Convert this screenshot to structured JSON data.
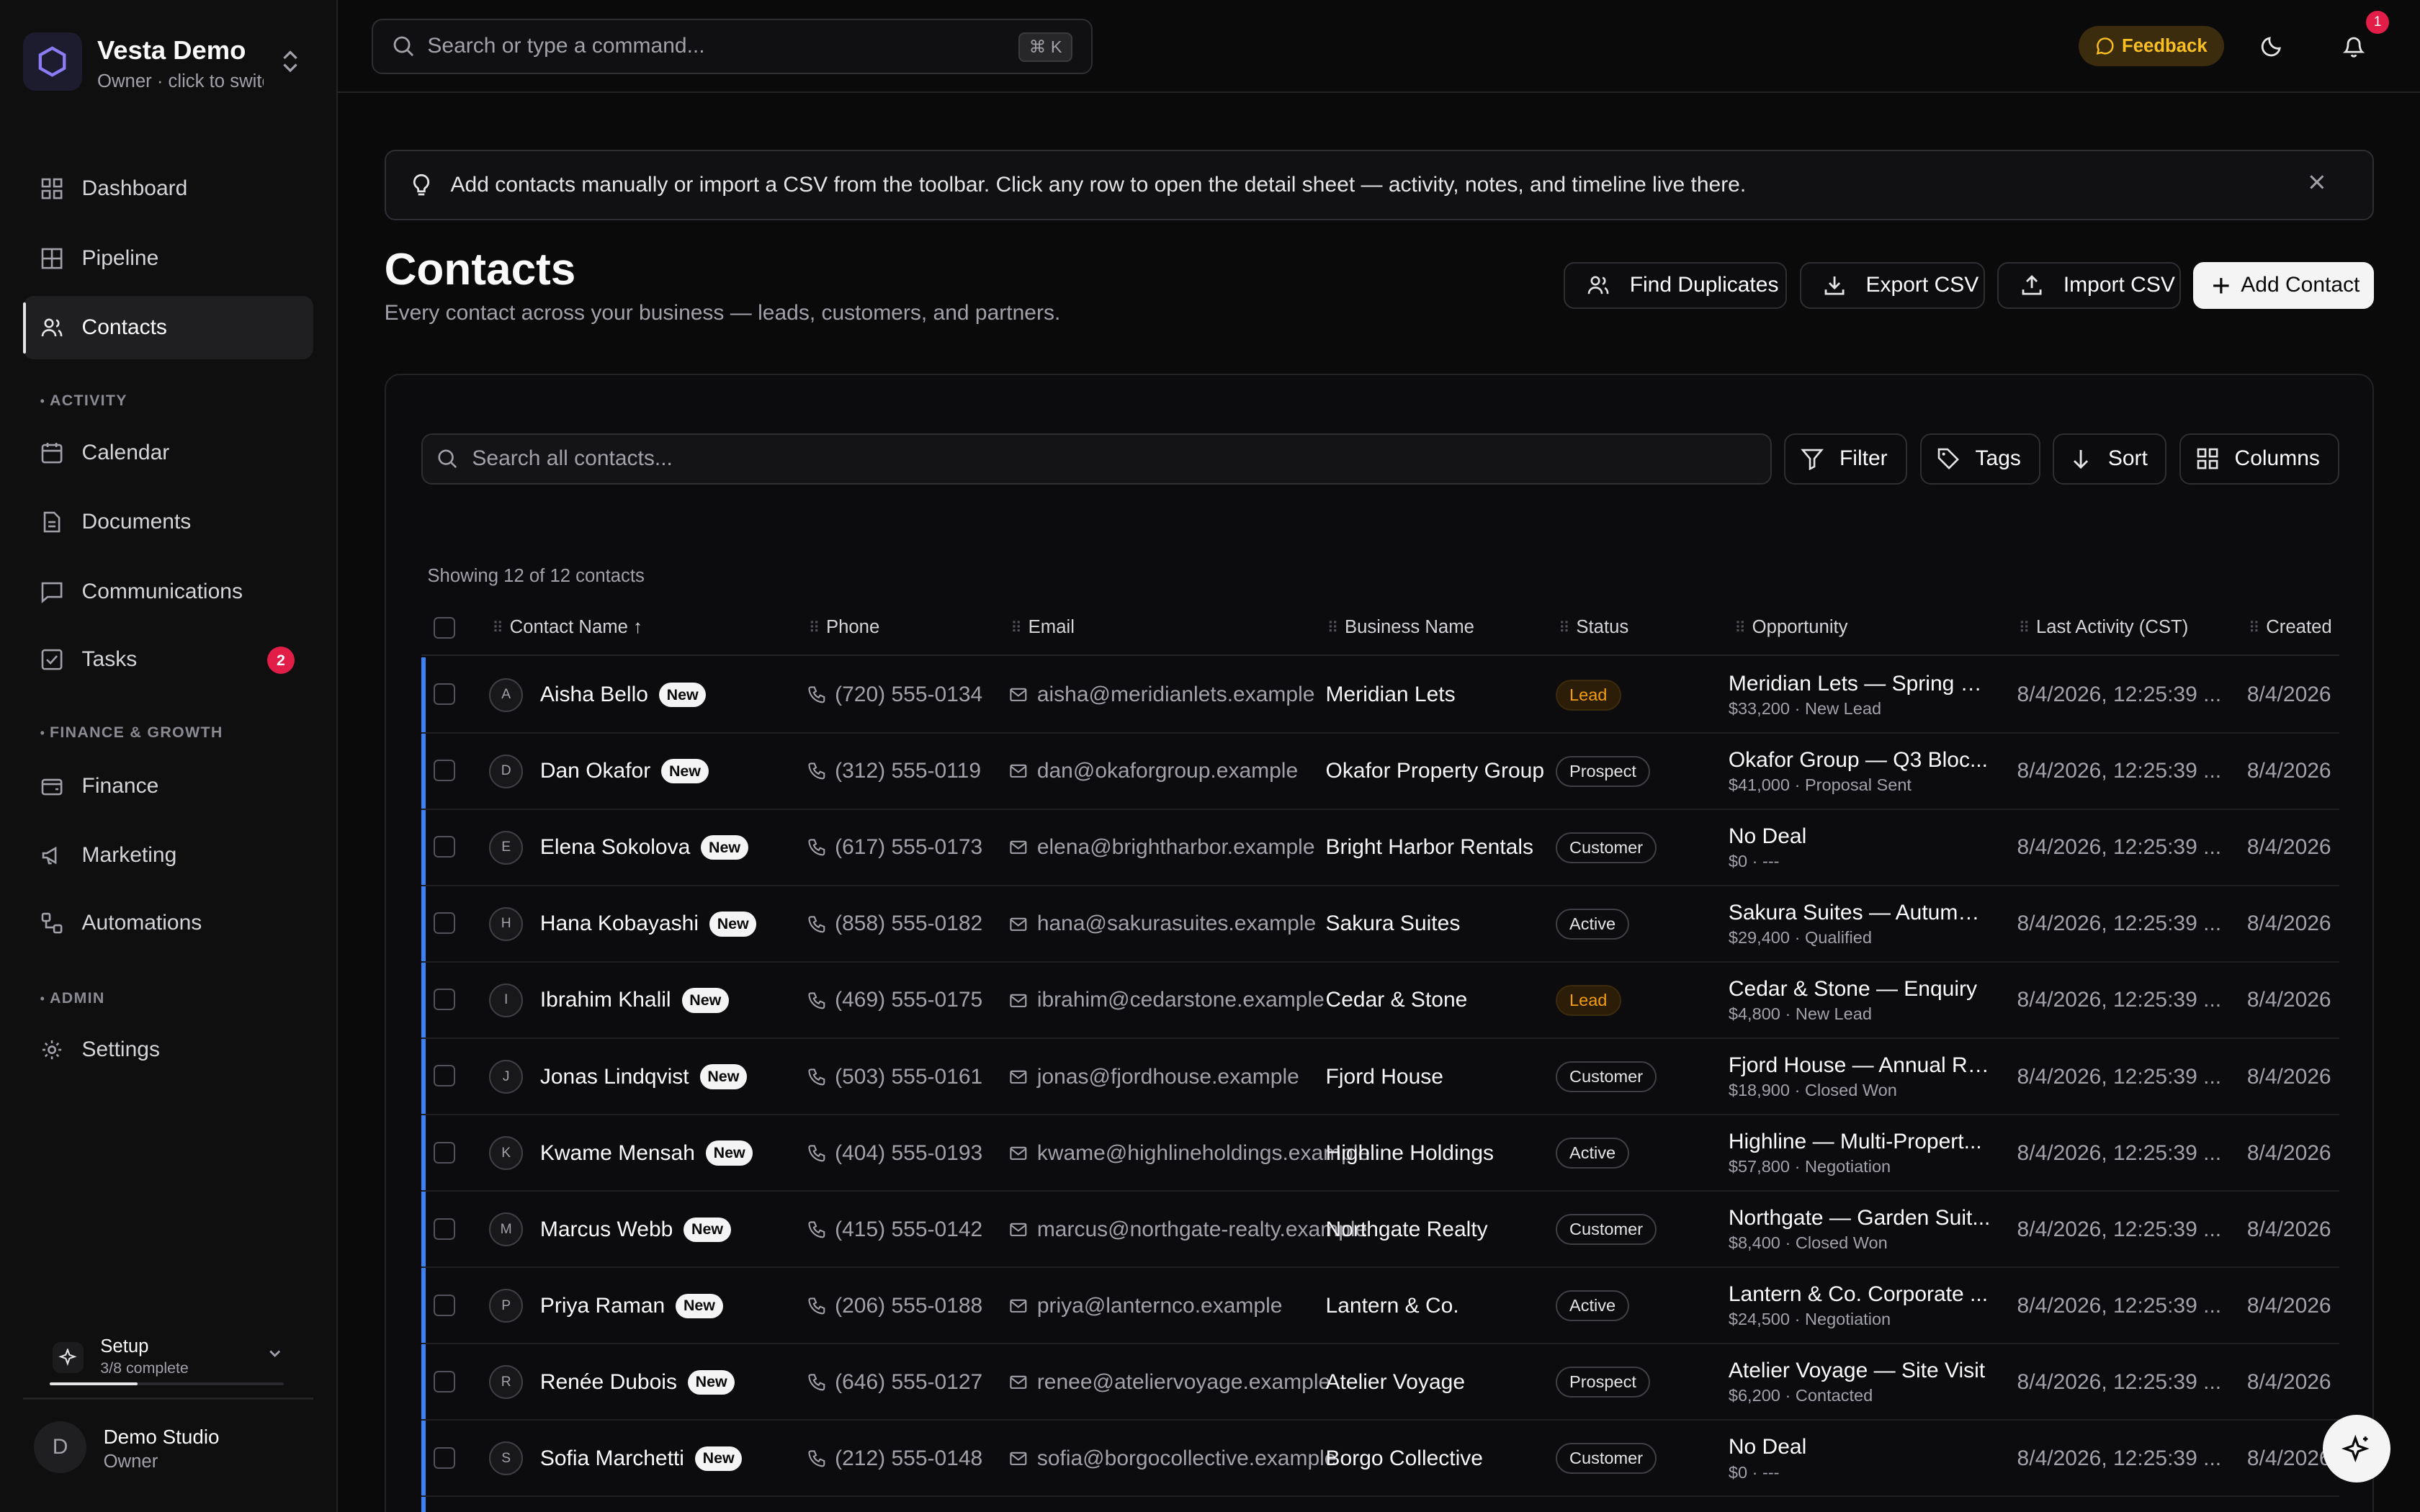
{
  "workspace": {
    "name": "Vesta Demo",
    "subtitle": "Owner · click to switch"
  },
  "sidebar": {
    "items": [
      {
        "label": "Dashboard"
      },
      {
        "label": "Pipeline"
      },
      {
        "label": "Contacts"
      },
      {
        "label": "Calendar"
      },
      {
        "label": "Documents"
      },
      {
        "label": "Communications"
      },
      {
        "label": "Tasks",
        "badge": "2"
      },
      {
        "label": "Finance"
      },
      {
        "label": "Marketing"
      },
      {
        "label": "Automations"
      },
      {
        "label": "Settings"
      }
    ],
    "sections": [
      "ACTIVITY",
      "FINANCE & GROWTH",
      "ADMIN"
    ],
    "active": "Contacts"
  },
  "setup": {
    "title": "Setup",
    "progress_text": "3/8 complete",
    "progress": 0.375
  },
  "user": {
    "initial": "D",
    "name": "Demo Studio",
    "role": "Owner"
  },
  "topbar": {
    "search_placeholder": "Search or type a command...",
    "shortcut": "⌘ K",
    "feedback_label": "Feedback",
    "notification_count": "1"
  },
  "banner": {
    "text": "Add contacts manually or import a CSV from the toolbar. Click any row to open the detail sheet — activity, notes, and timeline live there."
  },
  "page": {
    "title": "Contacts",
    "subtitle": "Every contact across your business — leads, customers, and partners."
  },
  "actions": {
    "find_duplicates": "Find Duplicates",
    "export_csv": "Export CSV",
    "import_csv": "Import CSV",
    "add_contact": "Add Contact"
  },
  "toolbar": {
    "search_placeholder": "Search all contacts...",
    "filter": "Filter",
    "tags": "Tags",
    "sort": "Sort",
    "columns": "Columns"
  },
  "table": {
    "showing": "Showing 12 of 12 contacts",
    "columns": [
      "Contact Name",
      "Phone",
      "Email",
      "Business Name",
      "Status",
      "Opportunity",
      "Last Activity (CST)",
      "Created"
    ],
    "new_label": "New",
    "rows": [
      {
        "initial": "A",
        "name": "Aisha Bello",
        "phone": "(720) 555-0134",
        "email": "aisha@meridianlets.example",
        "business": "Meridian Lets",
        "status": "Lead",
        "opp_title": "Meridian Lets — Spring B...",
        "opp_sub": "$33,200 · New Lead",
        "last": "8/4/2026, 12:25:39 ...",
        "created": "8/4/2026"
      },
      {
        "initial": "D",
        "name": "Dan Okafor",
        "phone": "(312) 555-0119",
        "email": "dan@okaforgroup.example",
        "business": "Okafor Property Group",
        "status": "Prospect",
        "opp_title": "Okafor Group — Q3 Bloc...",
        "opp_sub": "$41,000 · Proposal Sent",
        "last": "8/4/2026, 12:25:39 ...",
        "created": "8/4/2026"
      },
      {
        "initial": "E",
        "name": "Elena Sokolova",
        "phone": "(617) 555-0173",
        "email": "elena@brightharbor.example",
        "business": "Bright Harbor Rentals",
        "status": "Customer",
        "opp_title": "No Deal",
        "opp_sub": "$0 · ---",
        "last": "8/4/2026, 12:25:39 ...",
        "created": "8/4/2026"
      },
      {
        "initial": "H",
        "name": "Hana Kobayashi",
        "phone": "(858) 555-0182",
        "email": "hana@sakurasuites.example",
        "business": "Sakura Suites",
        "status": "Active",
        "opp_title": "Sakura Suites — Autumn ...",
        "opp_sub": "$29,400 · Qualified",
        "last": "8/4/2026, 12:25:39 ...",
        "created": "8/4/2026"
      },
      {
        "initial": "I",
        "name": "Ibrahim Khalil",
        "phone": "(469) 555-0175",
        "email": "ibrahim@cedarstone.example",
        "business": "Cedar & Stone",
        "status": "Lead",
        "opp_title": "Cedar & Stone — Enquiry",
        "opp_sub": "$4,800 · New Lead",
        "last": "8/4/2026, 12:25:39 ...",
        "created": "8/4/2026"
      },
      {
        "initial": "J",
        "name": "Jonas Lindqvist",
        "phone": "(503) 555-0161",
        "email": "jonas@fjordhouse.example",
        "business": "Fjord House",
        "status": "Customer",
        "opp_title": "Fjord House — Annual Re...",
        "opp_sub": "$18,900 · Closed Won",
        "last": "8/4/2026, 12:25:39 ...",
        "created": "8/4/2026"
      },
      {
        "initial": "K",
        "name": "Kwame Mensah",
        "phone": "(404) 555-0193",
        "email": "kwame@highlineholdings.example",
        "business": "Highline Holdings",
        "status": "Active",
        "opp_title": "Highline — Multi-Propert...",
        "opp_sub": "$57,800 · Negotiation",
        "last": "8/4/2026, 12:25:39 ...",
        "created": "8/4/2026"
      },
      {
        "initial": "M",
        "name": "Marcus Webb",
        "phone": "(415) 555-0142",
        "email": "marcus@northgate-realty.example",
        "business": "Northgate Realty",
        "status": "Customer",
        "opp_title": "Northgate — Garden Suit...",
        "opp_sub": "$8,400 · Closed Won",
        "last": "8/4/2026, 12:25:39 ...",
        "created": "8/4/2026"
      },
      {
        "initial": "P",
        "name": "Priya Raman",
        "phone": "(206) 555-0188",
        "email": "priya@lanternco.example",
        "business": "Lantern & Co.",
        "status": "Active",
        "opp_title": "Lantern & Co. Corporate ...",
        "opp_sub": "$24,500 · Negotiation",
        "last": "8/4/2026, 12:25:39 ...",
        "created": "8/4/2026"
      },
      {
        "initial": "R",
        "name": "Renée Dubois",
        "phone": "(646) 555-0127",
        "email": "renee@ateliervoyage.example",
        "business": "Atelier Voyage",
        "status": "Prospect",
        "opp_title": "Atelier Voyage — Site Visit",
        "opp_sub": "$6,200 · Contacted",
        "last": "8/4/2026, 12:25:39 ...",
        "created": "8/4/2026"
      },
      {
        "initial": "S",
        "name": "Sofia Marchetti",
        "phone": "(212) 555-0148",
        "email": "sofia@borgocollective.example",
        "business": "Borgo Collective",
        "status": "Customer",
        "opp_title": "No Deal",
        "opp_sub": "$0 · ---",
        "last": "8/4/2026, 12:25:39 ...",
        "created": "8/4/2026"
      }
    ]
  },
  "colors": {
    "accent": "#3b82f6",
    "lead": "#f59e0b",
    "badge": "#e11d48",
    "feedback": "#fbbf24"
  }
}
